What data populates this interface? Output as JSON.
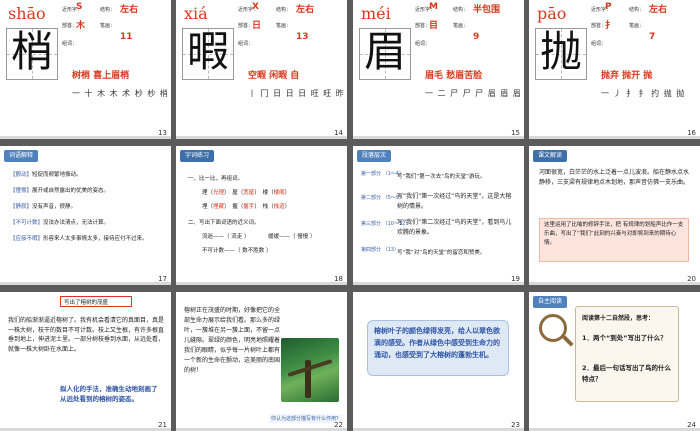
{
  "slides": {
    "s13": {
      "num": "13",
      "pinyin": "shāo",
      "char": "梢",
      "labels": {
        "radical": "部首：",
        "structure": "结构：",
        "strokes": "笔画：",
        "similar": "近形字：",
        "words": "组词："
      },
      "radical": "木",
      "structure": "左右",
      "strokes": "11",
      "similar_a": "S",
      "words": "树梢  喜上眉梢",
      "stroke_order": "一 十 木 木 术 杪 杪 梢 梢 梢 梢"
    },
    "s14": {
      "num": "14",
      "pinyin": "xiá",
      "char": "暇",
      "radical": "日",
      "structure": "左右",
      "strokes": "13",
      "similar_a": "X",
      "words": "空暇  闲暇  自",
      "stroke_order": "丨 冂 日 日 日 旺 旺 昨 暇 暇 暇 暇 暇"
    },
    "s15": {
      "num": "15",
      "pinyin": "méi",
      "char": "眉",
      "radical": "目",
      "structure": "半包围",
      "strokes": "9",
      "similar_a": "M",
      "words": "眉毛  愁眉苦脸",
      "stroke_order": "一 二 尸 尸 尸 眉 眉 眉 眉"
    },
    "s16": {
      "num": "16",
      "pinyin": "pāo",
      "char": "抛",
      "radical": "扌",
      "structure": "左右",
      "strokes": "7",
      "similar_a": "P",
      "words": "抛弃  抛开  抛",
      "stroke_order": "一 丿 扌 扌 扚 抛 抛"
    },
    "s17": {
      "num": "17",
      "tag": "词语解释",
      "lines": [
        {
          "k": "【颤动】",
          "v": "短促而频繁地振动。"
        },
        {
          "k": "【憧憬】",
          "v": "展开或自然露出的优美的姿态。"
        },
        {
          "k": "【静寂】",
          "v": "没有声音，很静。"
        },
        {
          "k": "【不可计数】",
          "v": "没法办法清点，无法计算。"
        },
        {
          "k": "【应接不暇】",
          "v": "形容来人太多事情太多，接待应付不过来。"
        }
      ]
    },
    "s18": {
      "num": "18",
      "tag": "字词练习",
      "l1": "一、比一比，再组词。",
      "pairs": [
        {
          "a": "理（",
          "b": "）",
          "c": "屋（",
          "d": "）",
          "e": "楼（",
          "f": "）"
        },
        {
          "a": "埋（",
          "b": "）",
          "c": "握（",
          "d": "）",
          "e": "栈（",
          "f": "）"
        }
      ],
      "answers": [
        "光理",
        "宽屋",
        "楼阁",
        "埋藏",
        "握手",
        "栈道"
      ],
      "l2": "二、写出下面词语的近义词。",
      "syn1": "流逝——（ 流走 ）",
      "syn2": "缓缓——（ 慢慢 ）",
      "syn3": "不可计数——（ 数不胜数 ）"
    },
    "s19": {
      "num": "19",
      "tag": "段落层次",
      "parts": [
        {
          "k": "第一部分\n（1～4）",
          "v": "写“我们”第一次去“鸟的天堂”游玩。"
        },
        {
          "k": "第二部分\n（5～9）",
          "v": "写“我们”第一次经过“鸟的天堂”，这是大榕树的情景。"
        },
        {
          "k": "第三部分\n（10～12）",
          "v": "写“我们”第二次经过“鸟的天堂”，看到鸟儿欢腾的景象。"
        },
        {
          "k": "第四部分\n（13）",
          "v": "写“我”对“鸟的天堂”的留恋和赞美。"
        }
      ]
    },
    "s20": {
      "num": "20",
      "tag": "课文解读",
      "p1": "河面很宽，白茫茫的水上泛着一点儿波浪。船在静水点水静移，三支梁有规律地点木划地，那声音仿佛一支乐曲。",
      "p2": "这里运用了比喻的修辞手法，把 有规律的划船声比作一支乐曲，写出了“我们”此刻的兴奋与对即将到来的期待心情。"
    },
    "s21": {
      "num": "21",
      "title": "写出了榕树的茂盛",
      "body": "我们的船渐渐逼近榕树了。我有机会看清它的真面目，真是一株大树，枝干的数目不可计数。枝上又生根，有许多根直垂到地上，伸进泥土里。一部分树枝垂到水面，从远处看，就像一株大树卧在水面上。",
      "note": "拟人化的手法，准确生动地刻画了从远处看到的榕树的姿态。"
    },
    "s22": {
      "num": "22",
      "body": "榕树正在茂盛的时期，好像把它的全部生命力展示给我们看。那么多的绿叶，一簇堆在另一簇上面，不留一点儿缝隙。翠绿的颜色，明亮地照耀着我们的眼睛，似乎每一片树叶上都有一个新的生命在颤动，这美丽的南国的树！",
      "caption": "你认为这部分描写有什么作用？"
    },
    "s23": {
      "num": "23",
      "body": "榕树叶子的颜色绿得发亮，给人以翠色欲滴的感受。作者从绿色中感受到生命力的涌动，也感受到了大榕树的蓬勃生机。"
    },
    "s24": {
      "num": "24",
      "tag": "自主阅读",
      "intro": "阅读第十二自然段，思考：",
      "q1": "1．两个“到处”写出了什么？",
      "q2": "2．最后一句话写出了鸟的什么特点？"
    }
  }
}
